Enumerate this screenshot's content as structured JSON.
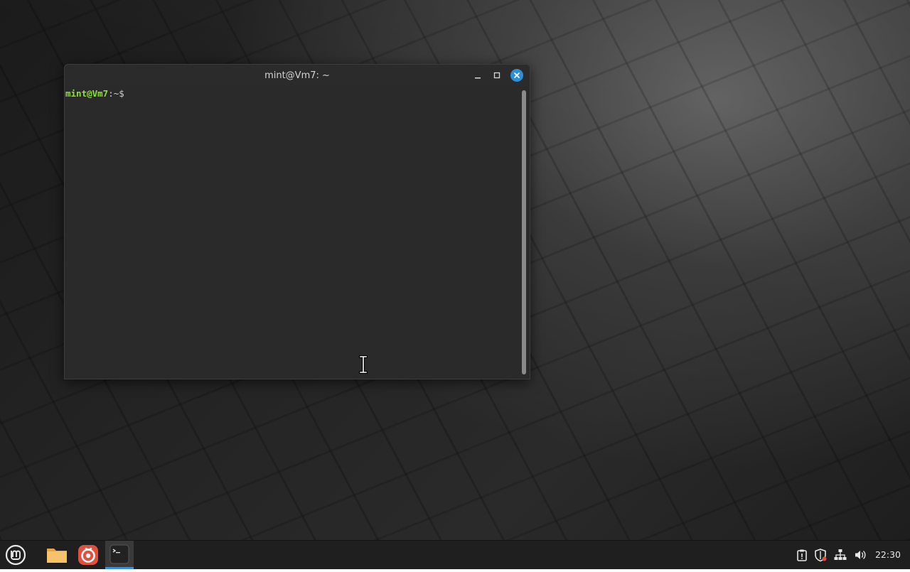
{
  "window": {
    "title": "mint@Vm7: ~",
    "buttons": {
      "minimize_icon": "minimize-icon",
      "maximize_icon": "maximize-icon",
      "close_icon": "close-icon"
    }
  },
  "terminal": {
    "prompt_user_host": "mint@Vm7",
    "prompt_path": ":~$",
    "input": "",
    "colors": {
      "background": "#2a2a2a",
      "prompt_user": "#8ae234",
      "text": "#d0d0d0"
    }
  },
  "taskbar": {
    "menu_icon": "linux-mint-logo-icon",
    "launchers": [
      {
        "name": "files",
        "icon": "folder-icon"
      },
      {
        "name": "browser",
        "icon": "firefox-icon"
      },
      {
        "name": "terminal",
        "icon": "terminal-icon",
        "active": true
      }
    ],
    "tray": [
      "clipboard-icon",
      "update-shield-icon",
      "network-icon",
      "volume-icon"
    ],
    "clock": "22:30",
    "accent_color": "#3a8fd6"
  }
}
